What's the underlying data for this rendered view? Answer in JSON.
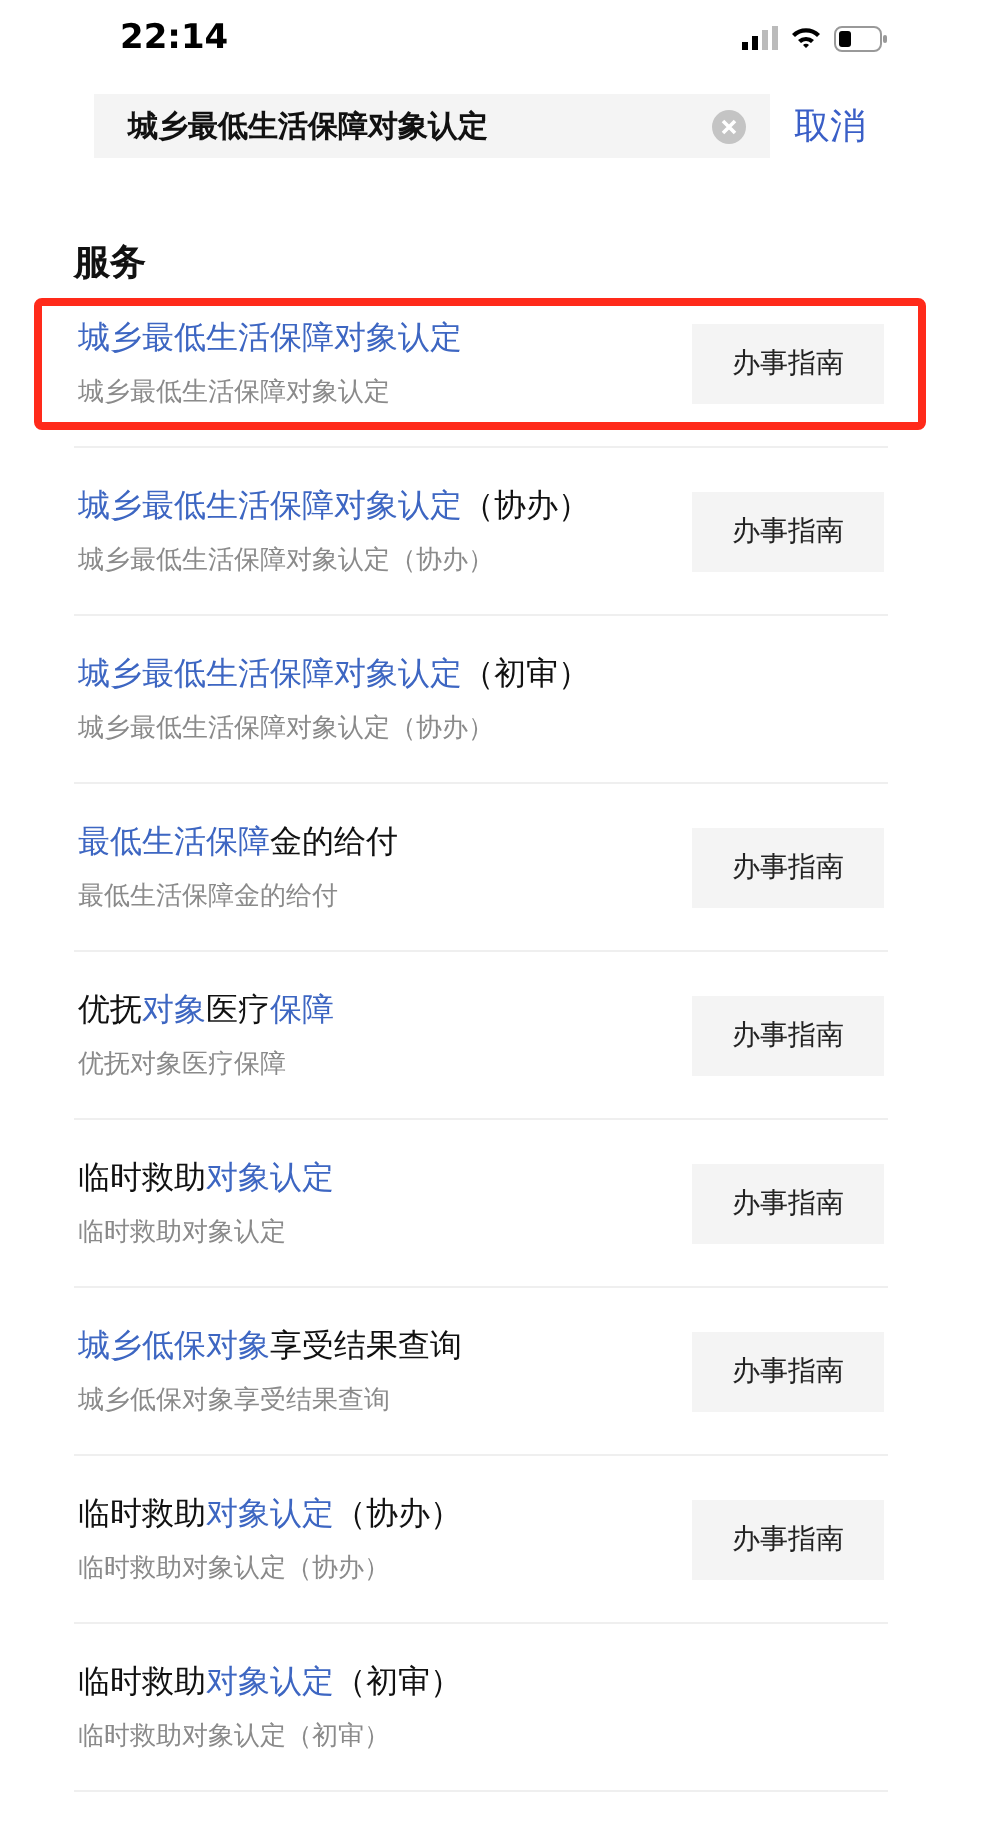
{
  "status_bar": {
    "time": "22:14"
  },
  "search": {
    "value": "城乡最低生活保障对象认定",
    "cancel": "取消"
  },
  "section": {
    "title": "服务"
  },
  "results": [
    {
      "title": [
        {
          "text": "城乡最低生活保障对象认定",
          "highlight": true
        }
      ],
      "subtitle": "城乡最低生活保障对象认定",
      "button": "办事指南",
      "outlined": true
    },
    {
      "title": [
        {
          "text": "城乡最低生活保障对象认定",
          "highlight": true
        },
        {
          "text": "（协办）",
          "highlight": false
        }
      ],
      "subtitle": "城乡最低生活保障对象认定（协办）",
      "button": "办事指南",
      "outlined": false
    },
    {
      "title": [
        {
          "text": "城乡最低生活保障对象认定",
          "highlight": true
        },
        {
          "text": "（初审）",
          "highlight": false
        }
      ],
      "subtitle": "城乡最低生活保障对象认定（协办）",
      "outlined": false
    },
    {
      "title": [
        {
          "text": "最低生活保障",
          "highlight": true
        },
        {
          "text": "金的给付",
          "highlight": false
        }
      ],
      "subtitle": "最低生活保障金的给付",
      "button": "办事指南",
      "outlined": false
    },
    {
      "title": [
        {
          "text": "优抚",
          "highlight": false
        },
        {
          "text": "对象",
          "highlight": true
        },
        {
          "text": "医疗",
          "highlight": false
        },
        {
          "text": "保障",
          "highlight": true
        }
      ],
      "subtitle": "优抚对象医疗保障",
      "button": "办事指南",
      "outlined": false
    },
    {
      "title": [
        {
          "text": "临时救助",
          "highlight": false
        },
        {
          "text": "对象认定",
          "highlight": true
        }
      ],
      "subtitle": "临时救助对象认定",
      "button": "办事指南",
      "outlined": false
    },
    {
      "title": [
        {
          "text": "城乡低保对象",
          "highlight": true
        },
        {
          "text": "享受结果查询",
          "highlight": false
        }
      ],
      "subtitle": "城乡低保对象享受结果查询",
      "button": "办事指南",
      "outlined": false
    },
    {
      "title": [
        {
          "text": "临时救助",
          "highlight": false
        },
        {
          "text": "对象认定",
          "highlight": true
        },
        {
          "text": "（协办）",
          "highlight": false
        }
      ],
      "subtitle": "临时救助对象认定（协办）",
      "button": "办事指南",
      "outlined": false
    },
    {
      "title": [
        {
          "text": "临时救助",
          "highlight": false
        },
        {
          "text": "对象认定",
          "highlight": true
        },
        {
          "text": "（初审）",
          "highlight": false
        }
      ],
      "subtitle": "临时救助对象认定（初审）",
      "outlined": false
    }
  ]
}
